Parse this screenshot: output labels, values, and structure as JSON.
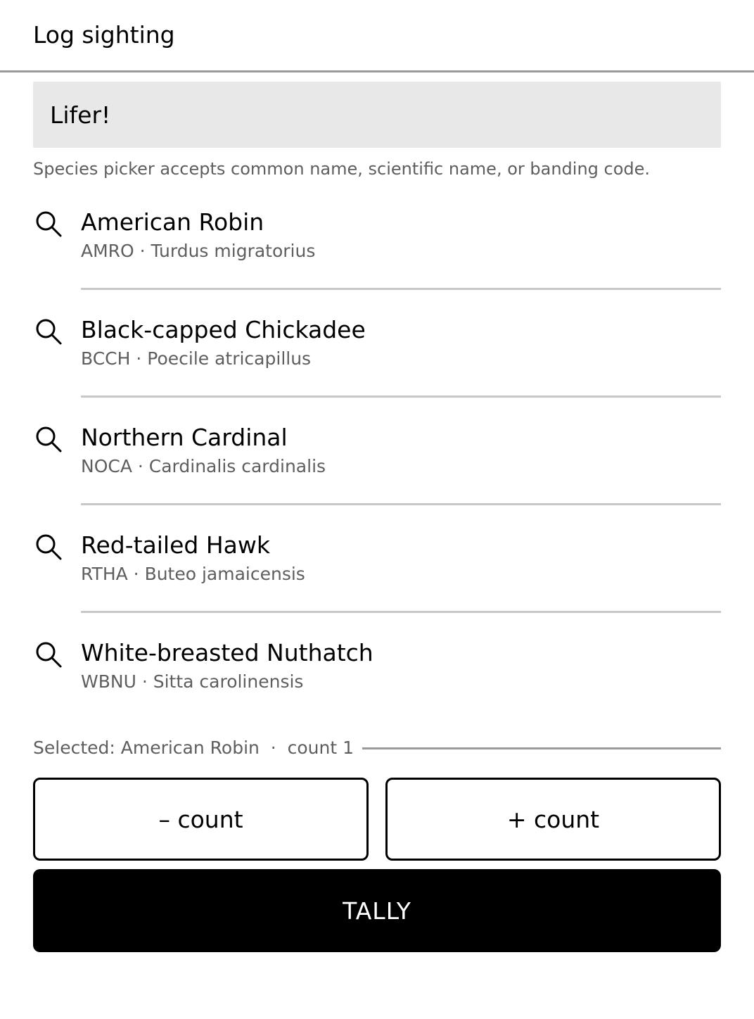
{
  "header": {
    "title": "Log sighting"
  },
  "search": {
    "value": "Lifer!",
    "placeholder": ""
  },
  "hint": "Species picker accepts common name, scientific name, or banding code.",
  "species": [
    {
      "name": "American Robin",
      "sub": "AMRO · Turdus migratorius",
      "icon": "search-icon"
    },
    {
      "name": "Black-capped Chickadee",
      "sub": "BCCH · Poecile atricapillus",
      "icon": "search-icon"
    },
    {
      "name": "Northern Cardinal",
      "sub": "NOCA · Cardinalis cardinalis",
      "icon": "search-icon"
    },
    {
      "name": "Red-tailed Hawk",
      "sub": "RTHA · Buteo jamaicensis",
      "icon": "search-icon"
    },
    {
      "name": "White-breasted Nuthatch",
      "sub": "WBNU · Sitta carolinensis",
      "icon": "search-icon"
    }
  ],
  "status": {
    "text": "Selected: American Robin  ·  count 1"
  },
  "buttons": {
    "decrement": "– count",
    "increment": "+ count",
    "tally": "TALLY"
  },
  "colors": {
    "primary": "#000000",
    "field_background": "#e8e8e8",
    "secondary_text": "#5e5e5e",
    "divider": "#c8c8c8"
  }
}
